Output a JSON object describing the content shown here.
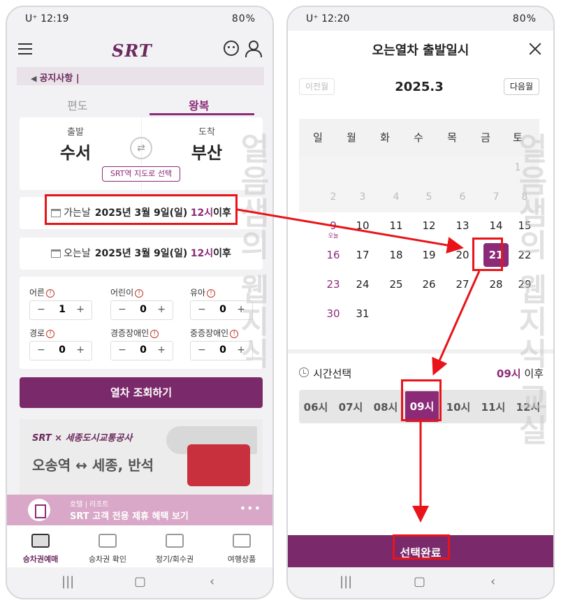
{
  "phoneA": {
    "status": {
      "time": "12:19",
      "carrier": "U⁺",
      "right": "80%"
    },
    "logo": "SRT",
    "notice": "공지사항",
    "tabs": [
      "편도",
      "왕복"
    ],
    "route": {
      "from_label": "출발",
      "from": "수서",
      "to_label": "도착",
      "to": "부산",
      "map_button": "SRT역 지도로 선택"
    },
    "depart": {
      "label": "가는날",
      "date": "2025년 3월 9일(일)",
      "hour": "12시",
      "suffix": "이후"
    },
    "return": {
      "label": "오는날",
      "date": "2025년 3월 9일(일)",
      "hour": "12시",
      "suffix": "이후"
    },
    "passengers": [
      {
        "label": "어른",
        "value": "1"
      },
      {
        "label": "어린이",
        "value": "0"
      },
      {
        "label": "유아",
        "value": "0"
      },
      {
        "label": "경로",
        "value": "0"
      },
      {
        "label": "경증장애인",
        "value": "0"
      },
      {
        "label": "중증장애인",
        "value": "0"
      }
    ],
    "stepper": {
      "minus": "−",
      "plus": "+"
    },
    "search_button": "열차 조회하기",
    "banner": {
      "brand": "SRT × 세종도시교통공사",
      "title": "오송역 ↔ 세종, 반석"
    },
    "promo": {
      "sub": "호텔 | 리조트",
      "title": "SRT 고객 전용 제휴 혜택 보기",
      "more": "•••"
    },
    "bottom_nav": [
      "승차권예매",
      "승차권 확인",
      "정기/회수권",
      "여행상품"
    ],
    "watermark": "얼음샘의 웹지식"
  },
  "phoneB": {
    "status": {
      "time": "12:20",
      "carrier": "U⁺",
      "right": "80%"
    },
    "title": "오는열차 출발일시",
    "prev_month": "이전월",
    "next_month": "다음월",
    "month": "2025.3",
    "weekdays": [
      "일",
      "월",
      "화",
      "수",
      "목",
      "금",
      "토"
    ],
    "today_label": "오늘",
    "selected_day": "21",
    "time_label": "시간선택",
    "time_after_hour": "09시",
    "time_after_suffix": "이후",
    "hours": [
      "06시",
      "07시",
      "08시",
      "09시",
      "10시",
      "11시",
      "12시"
    ],
    "selected_hour": "09시",
    "confirm": "선택완료",
    "watermark": "얼음샘의 웹지식 교실"
  },
  "colors": {
    "brand": "#7a2a6a",
    "accent": "#8c2a78",
    "annotation": "#e8141a"
  }
}
